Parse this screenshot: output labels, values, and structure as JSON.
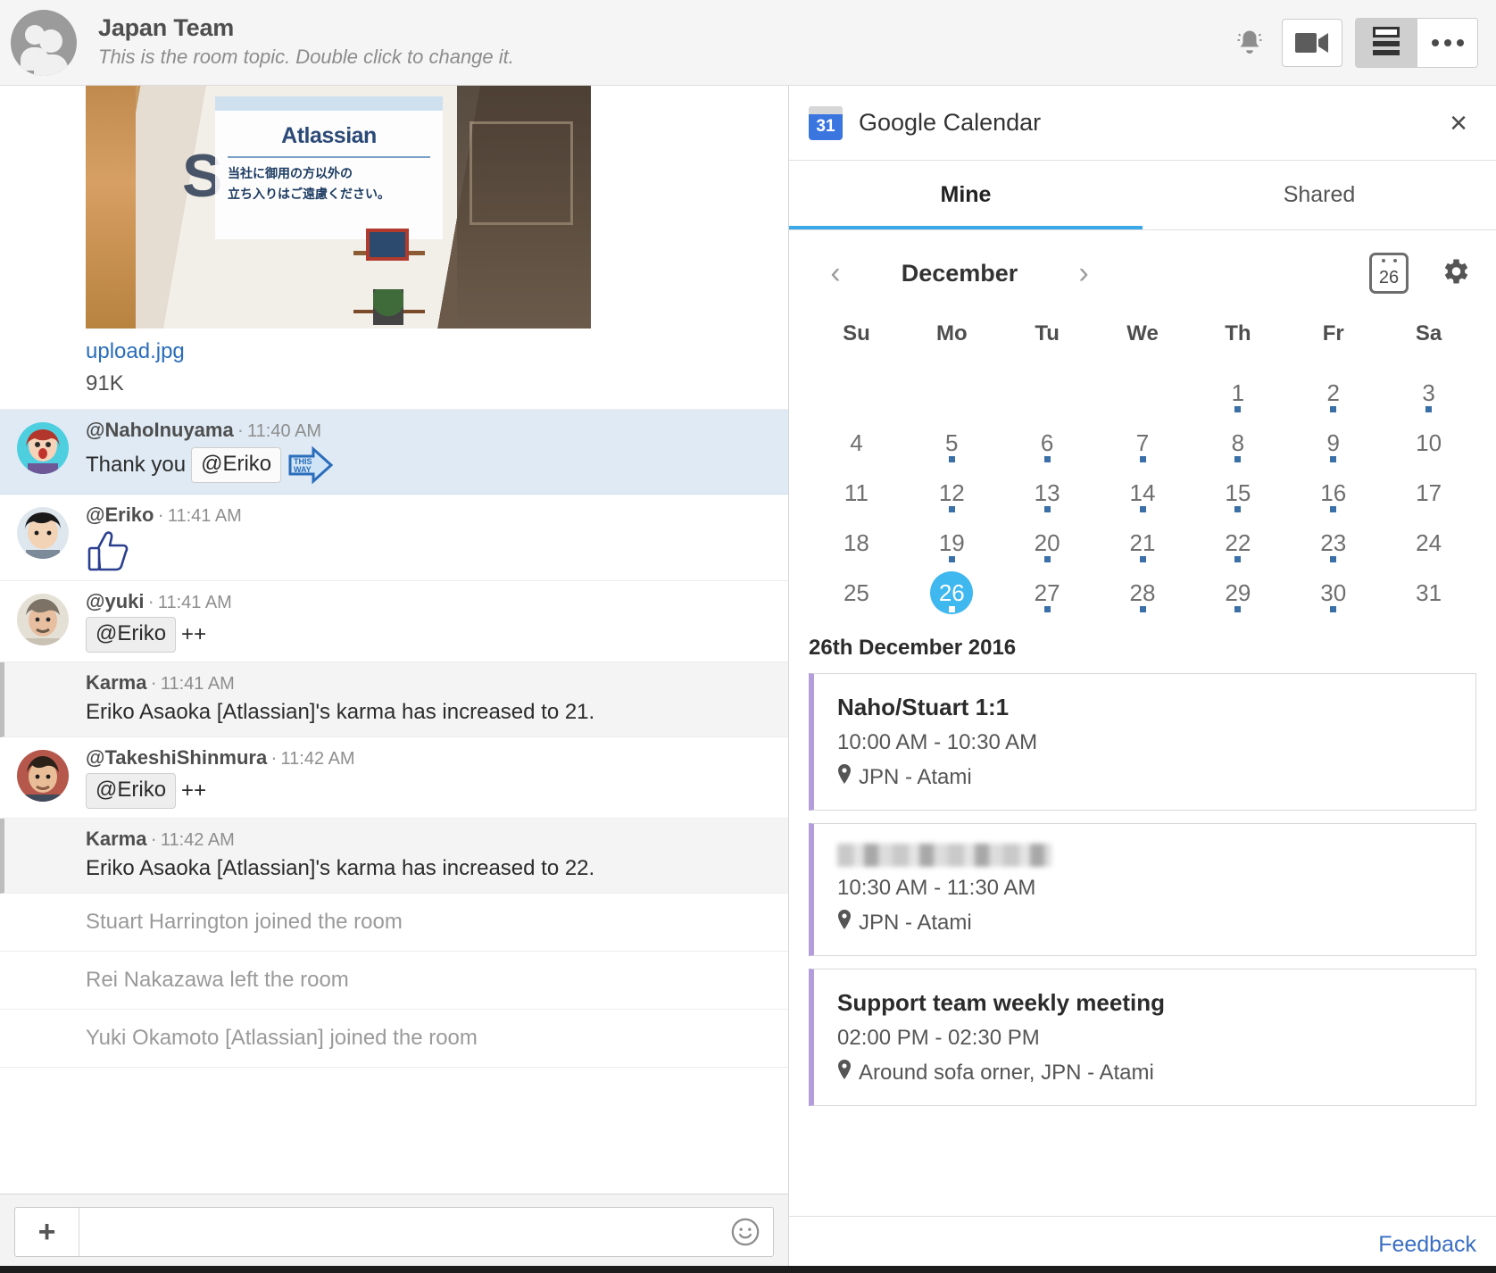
{
  "header": {
    "room_name": "Japan Team",
    "room_topic": "This is the room topic. Double click to change it.",
    "icons": {
      "bell": "bell-icon",
      "video": "video-camera-icon",
      "lines": "compact-view-icon",
      "more": "more-options-icon"
    }
  },
  "chat": {
    "attachment": {
      "filename": "upload.jpg",
      "filesize": "91K",
      "image_alt": "Atlassian office entrance sign",
      "sign_logo": "Atlassian",
      "sign_line1": "当社に御用の方以外の",
      "sign_line2": "立ち入りはご遠慮ください。",
      "sign_big_letter": "S"
    },
    "messages": [
      {
        "type": "message",
        "author": "@NahoInuyama",
        "time": "11:40 AM",
        "text": "Thank you",
        "mention": "@Eriko",
        "emoticon": "this-way",
        "highlight": true
      },
      {
        "type": "message",
        "author": "@Eriko",
        "time": "11:41 AM",
        "text": "",
        "emoticon": "thumbs-up",
        "highlight": false
      },
      {
        "type": "message",
        "author": "@yuki",
        "time": "11:41 AM",
        "mention": "@Eriko",
        "text": "++",
        "highlight": false
      },
      {
        "type": "system",
        "author": "Karma",
        "time": "11:41 AM",
        "text": "Eriko Asaoka [Atlassian]'s karma has increased to 21."
      },
      {
        "type": "message",
        "author": "@TakeshiShinmura",
        "time": "11:42 AM",
        "mention": "@Eriko",
        "text": "++",
        "highlight": false
      },
      {
        "type": "system",
        "author": "Karma",
        "time": "11:42 AM",
        "text": "Eriko Asaoka [Atlassian]'s karma has increased to 22."
      },
      {
        "type": "presence",
        "text": "Stuart Harrington joined the room"
      },
      {
        "type": "presence",
        "text": "Rei Nakazawa left the room"
      },
      {
        "type": "presence",
        "text": "Yuki Okamoto [Atlassian] joined the room"
      }
    ],
    "composer": {
      "add_label": "+",
      "placeholder": "",
      "value": "",
      "emoji_icon": "smiley-icon"
    }
  },
  "calendar_panel": {
    "title": "Google Calendar",
    "icon_day": "31",
    "close_label": "×",
    "tabs": [
      {
        "label": "Mine",
        "active": true
      },
      {
        "label": "Shared",
        "active": false
      }
    ],
    "month": "December",
    "prev_label": "‹",
    "next_label": "›",
    "today_button_day": "26",
    "accent_color": "#3fb7ef",
    "event_accent_color": "#b39ddb",
    "dow": [
      "Su",
      "Mo",
      "Tu",
      "We",
      "Th",
      "Fr",
      "Sa"
    ],
    "weeks": [
      [
        {
          "day": "",
          "dot": false
        },
        {
          "day": "",
          "dot": false
        },
        {
          "day": "",
          "dot": false
        },
        {
          "day": "",
          "dot": false
        },
        {
          "day": "1",
          "dot": true
        },
        {
          "day": "2",
          "dot": true
        },
        {
          "day": "3",
          "dot": true
        }
      ],
      [
        {
          "day": "4",
          "dot": false
        },
        {
          "day": "5",
          "dot": true
        },
        {
          "day": "6",
          "dot": true
        },
        {
          "day": "7",
          "dot": true
        },
        {
          "day": "8",
          "dot": true
        },
        {
          "day": "9",
          "dot": true
        },
        {
          "day": "10",
          "dot": false
        }
      ],
      [
        {
          "day": "11",
          "dot": false
        },
        {
          "day": "12",
          "dot": true
        },
        {
          "day": "13",
          "dot": true
        },
        {
          "day": "14",
          "dot": true
        },
        {
          "day": "15",
          "dot": true
        },
        {
          "day": "16",
          "dot": true
        },
        {
          "day": "17",
          "dot": false
        }
      ],
      [
        {
          "day": "18",
          "dot": false
        },
        {
          "day": "19",
          "dot": true
        },
        {
          "day": "20",
          "dot": true
        },
        {
          "day": "21",
          "dot": true
        },
        {
          "day": "22",
          "dot": true
        },
        {
          "day": "23",
          "dot": true
        },
        {
          "day": "24",
          "dot": false
        }
      ],
      [
        {
          "day": "25",
          "dot": false
        },
        {
          "day": "26",
          "dot": true,
          "selected": true
        },
        {
          "day": "27",
          "dot": true
        },
        {
          "day": "28",
          "dot": true
        },
        {
          "day": "29",
          "dot": true
        },
        {
          "day": "30",
          "dot": true
        },
        {
          "day": "31",
          "dot": false
        }
      ]
    ],
    "events_date": "26th December 2016",
    "events": [
      {
        "title": "Naho/Stuart 1:1",
        "time": "10:00 AM - 10:30 AM",
        "location": "JPN - Atami",
        "redacted": false
      },
      {
        "title": "",
        "time": "10:30 AM - 11:30 AM",
        "location": "JPN - Atami",
        "redacted": true
      },
      {
        "title": "Support team weekly meeting",
        "time": "02:00 PM - 02:30 PM",
        "location": "Around sofa orner, JPN - Atami",
        "redacted": false
      }
    ],
    "feedback_label": "Feedback"
  }
}
